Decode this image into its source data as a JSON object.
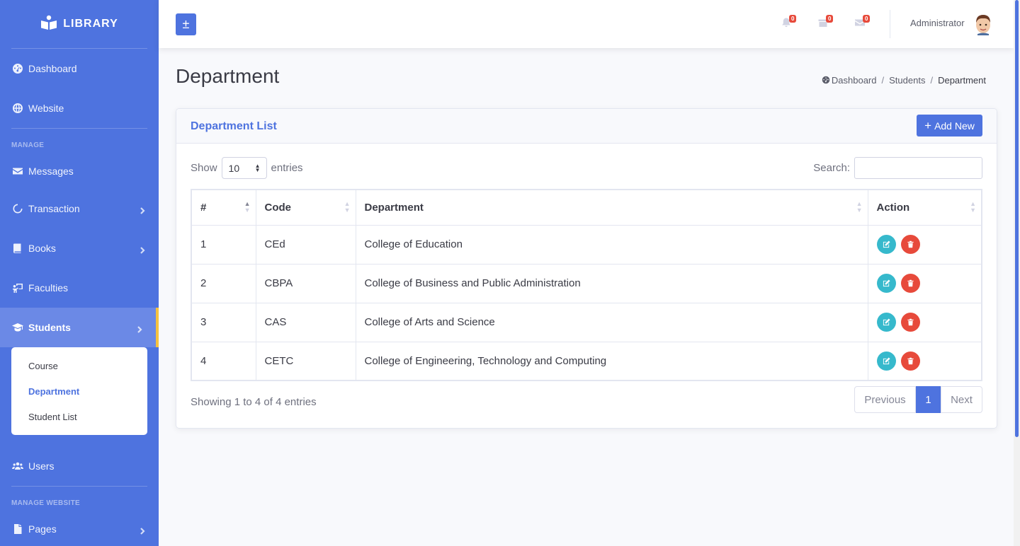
{
  "sidebar": {
    "brand": "LIBRARY",
    "items": [
      {
        "label": "Dashboard",
        "icon": "dashboard-icon"
      },
      {
        "label": "Website",
        "icon": "globe-icon"
      }
    ],
    "heading_manage": "MANAGE",
    "manage_items": [
      {
        "label": "Messages",
        "icon": "envelope-icon"
      },
      {
        "label": "Transaction",
        "icon": "circle-notch-icon"
      },
      {
        "label": "Books",
        "icon": "book-icon"
      },
      {
        "label": "Faculties",
        "icon": "chalkboard-teacher-icon"
      },
      {
        "label": "Students",
        "icon": "graduation-cap-icon"
      }
    ],
    "students_submenu": [
      "Course",
      "Department",
      "Student List"
    ],
    "users": {
      "label": "Users",
      "icon": "users-icon"
    },
    "heading_website": "MANAGE WEBSITE",
    "pages": {
      "label": "Pages",
      "icon": "file-icon"
    }
  },
  "topbar": {
    "toggle_label": "±",
    "notifications_count": "0",
    "boxes_count": "0",
    "messages_count": "0",
    "user_name": "Administrator"
  },
  "page": {
    "title": "Department",
    "breadcrumb": [
      "Dashboard",
      "Students",
      "Department"
    ]
  },
  "card": {
    "title": "Department List",
    "add_button": "Add New",
    "show_label": "Show",
    "entries_value": "10",
    "entries_label": "entries",
    "search_label": "Search:",
    "search_value": "",
    "columns": [
      "#",
      "Code",
      "Department",
      "Action"
    ],
    "rows": [
      [
        "1",
        "CEd",
        "College of Education"
      ],
      [
        "2",
        "CBPA",
        "College of Business and Public Administration"
      ],
      [
        "3",
        "CAS",
        "College of Arts and Science"
      ],
      [
        "4",
        "CETC",
        "College of Engineering, Technology and Computing"
      ]
    ],
    "info": "Showing 1 to 4 of 4 entries",
    "pager": {
      "previous": "Previous",
      "current": "1",
      "next": "Next"
    }
  },
  "colors": {
    "primary": "#4e73df",
    "warning_accent": "#f6c23e",
    "edit": "#36b9cc",
    "delete": "#e74a3b"
  }
}
